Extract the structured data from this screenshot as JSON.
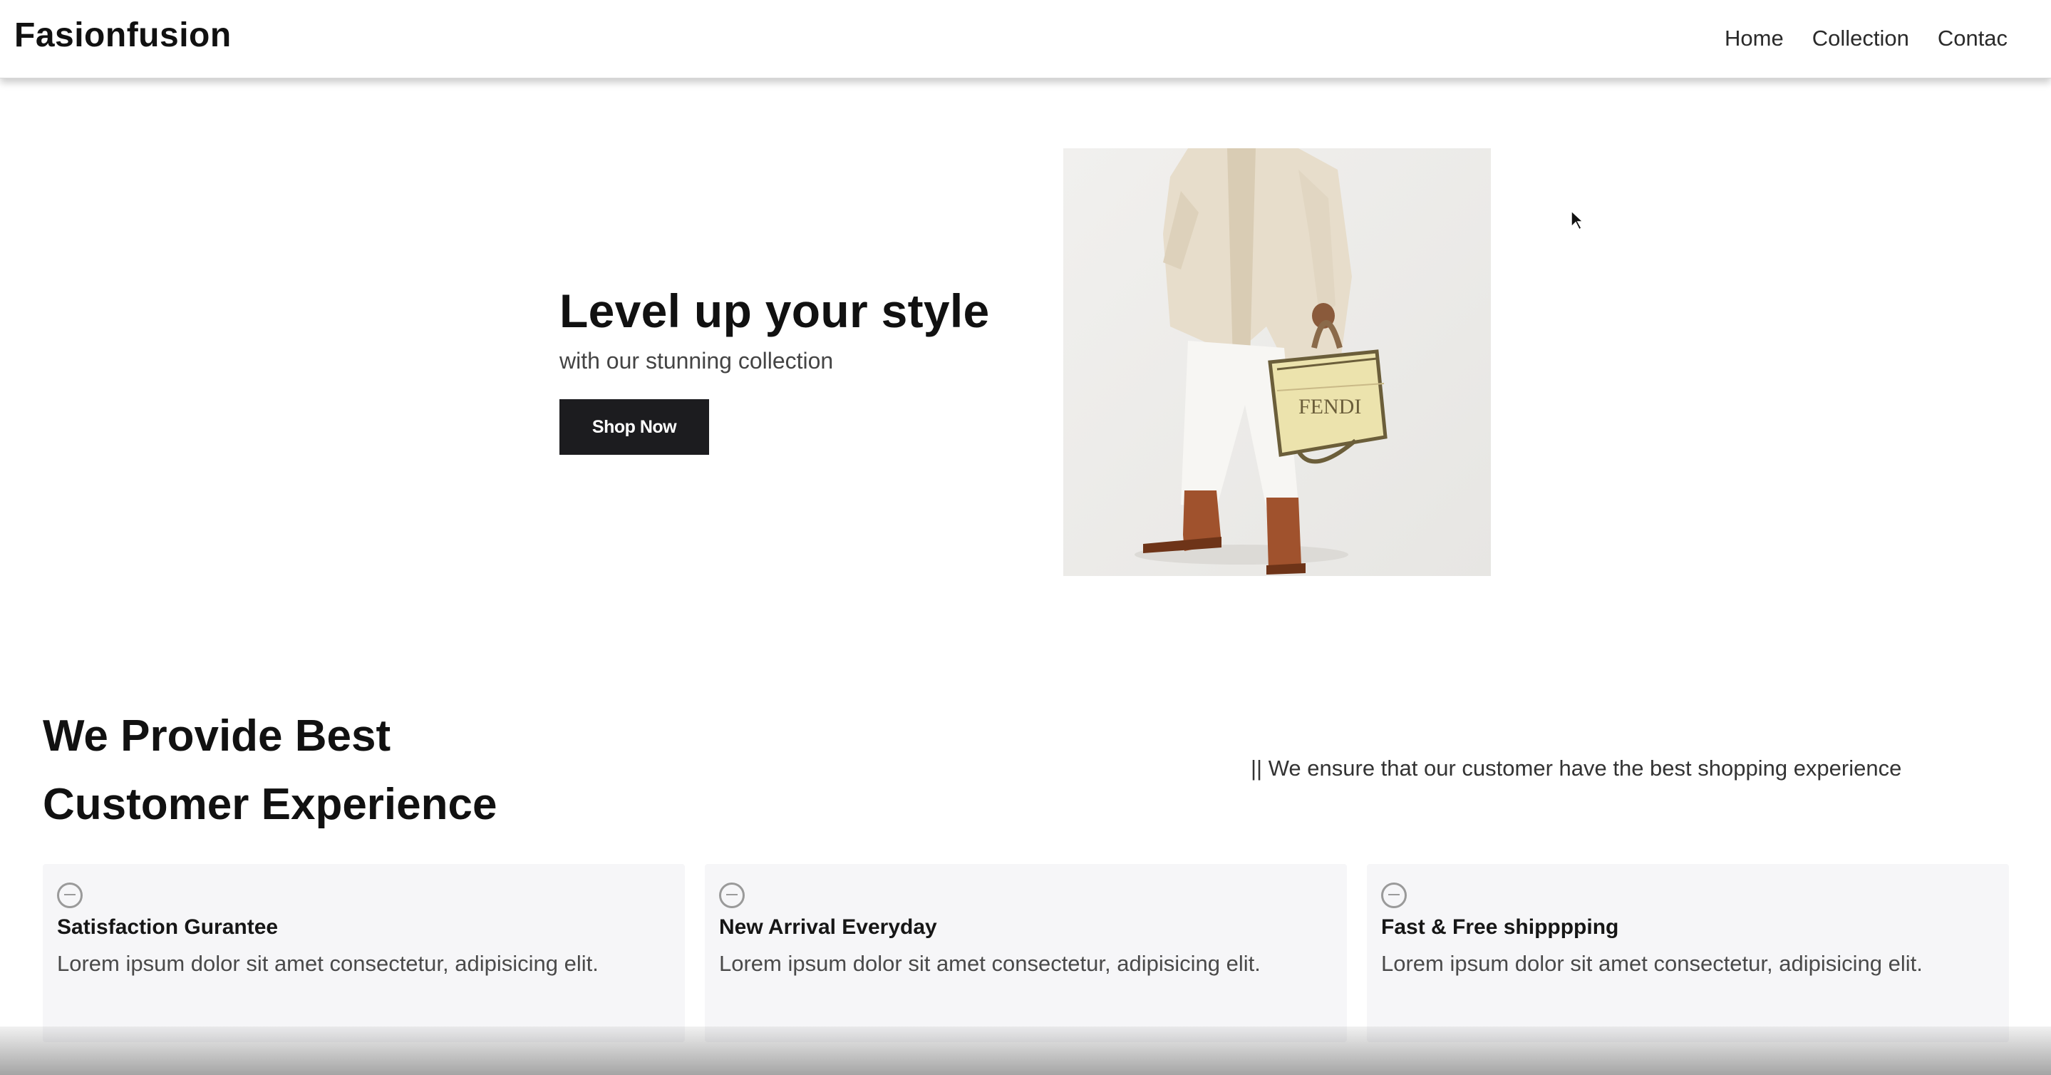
{
  "header": {
    "brand": "Fasionfusion",
    "nav": [
      "Home",
      "Collection",
      "Contac"
    ]
  },
  "hero": {
    "title": "Level up your style",
    "subtitle": "with our stunning collection",
    "button_label": "Shop Now",
    "image_label": "FENDI"
  },
  "features": {
    "title_line1": "We Provide Best",
    "title_line2": "Customer Experience",
    "note": "|| We ensure that our customer have the best shopping experience",
    "cards": [
      {
        "icon": "smiley-icon",
        "title": "Satisfaction Gurantee",
        "text": "Lorem ipsum dolor sit amet consectetur, adipisicing elit."
      },
      {
        "icon": "smiley-icon",
        "title": "New Arrival Everyday",
        "text": "Lorem ipsum dolor sit amet consectetur, adipisicing elit."
      },
      {
        "icon": "smiley-icon",
        "title": "Fast & Free shipppping",
        "text": "Lorem ipsum dolor sit amet consectetur, adipisicing elit."
      }
    ]
  },
  "colors": {
    "button_bg": "#1c1c1f",
    "card_bg": "#f6f6f8",
    "text": "#111111"
  }
}
